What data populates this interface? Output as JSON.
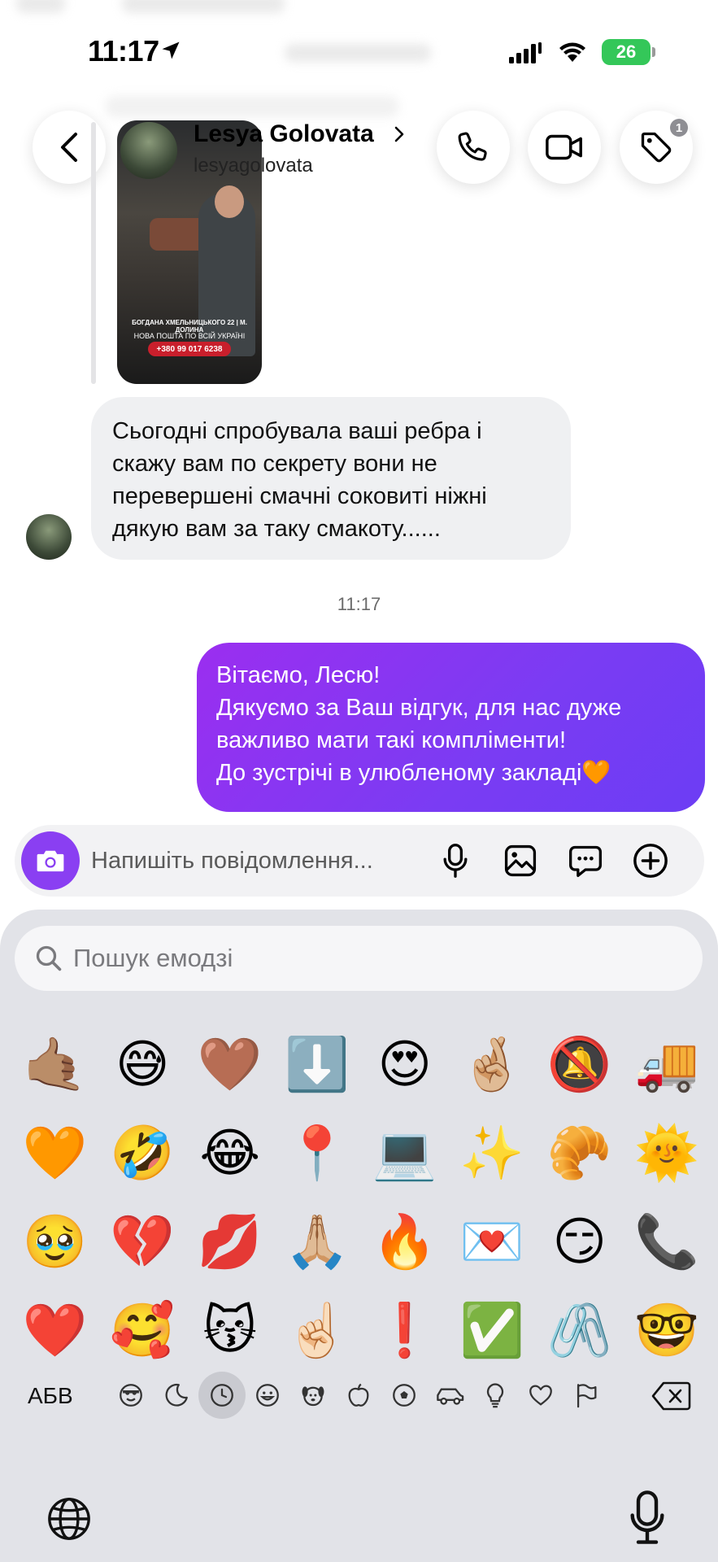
{
  "status_bar": {
    "time": "11:17",
    "battery": "26"
  },
  "header": {
    "name": "Lesya Golovata",
    "username": "lesyagolovata",
    "tag_badge_count": "1"
  },
  "story_reply": {
    "address": "БОГДАНА ХМЕЛЬНИЦЬКОГО 22 | М. ДОЛИНА",
    "delivery": "НОВА ПОШТА ПО ВСІЙ УКРАЇНІ",
    "phone": "+380 99 017 6238"
  },
  "messages": [
    {
      "direction": "incoming",
      "text": "Сьогодні спробувала ваші ребра і\nскажу вам по секрету вони не\nперевершені смачні соковиті ніжні\nдякую вам за таку смакоту......"
    },
    {
      "direction": "timestamp",
      "text": "11:17"
    },
    {
      "direction": "outgoing",
      "text": "Вітаємо, Лесю!\nДякуємо за Ваш відгук, для нас дуже\nважливо мати такі компліменти!\nДо зустрічі в улюбленому закладі🧡"
    }
  ],
  "composer": {
    "placeholder": "Напишіть повідомлення...",
    "value": ""
  },
  "keyboard": {
    "search_placeholder": "Пошук емодзі",
    "abc_label": "АБВ",
    "emojis": [
      "🤙🏽",
      "😅",
      "🤎",
      "⬇️",
      "😍",
      "🤞🏼",
      "🔕",
      "🚚",
      "🧡",
      "🤣",
      "😂",
      "📍",
      "💻",
      "✨",
      "🥐",
      "🌞",
      "🥹",
      "💔",
      "💋",
      "🙏🏼",
      "🔥",
      "💌",
      "😏",
      "📞",
      "❤️",
      "🥰",
      "😽",
      "☝🏻",
      "❗",
      "✅",
      "🖇️",
      "🤓"
    ],
    "categories": [
      "memoji",
      "stickers",
      "recent",
      "smileys",
      "animals",
      "food",
      "activity",
      "travel",
      "objects",
      "symbols",
      "flags"
    ],
    "active_category": "recent"
  },
  "colors": {
    "outgoing_bubble": "#7a3cf3",
    "incoming_bubble": "#eff0f2",
    "camera_button": "#8a3ff2",
    "battery": "#34c759"
  }
}
